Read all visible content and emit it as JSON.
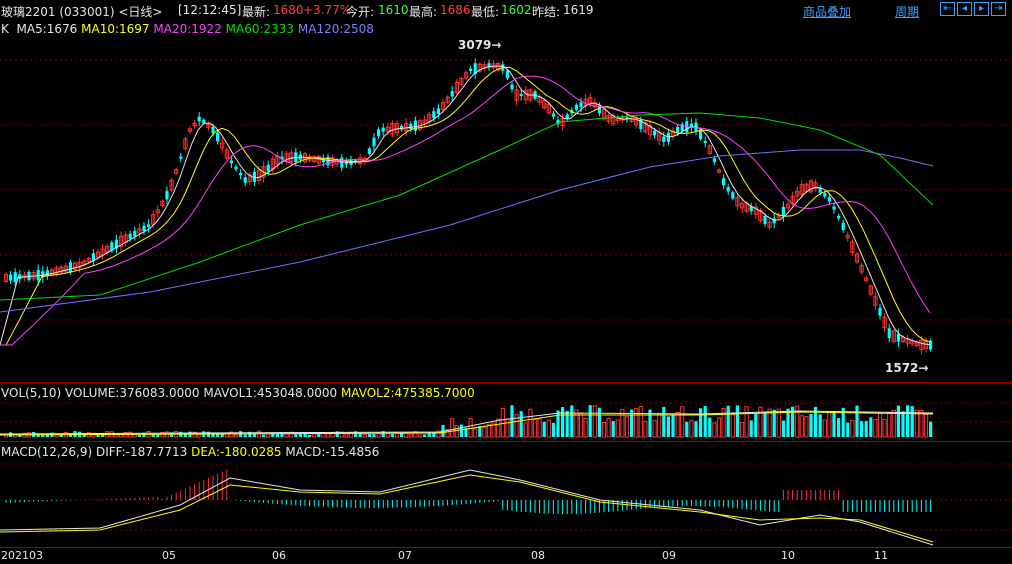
{
  "header": {
    "instrument": "玻璃2201 (033001) <日线>",
    "time": "[12:12:45]",
    "last_label": "最新:",
    "last_value": "1680",
    "change_pct": "+3.77%",
    "open_label": "今开:",
    "open_value": "1610",
    "high_label": "最高:",
    "high_value": "1686",
    "low_label": "最低:",
    "low_value": "1602",
    "prev_close_label": "昨结:",
    "prev_close_value": "1619",
    "overlay_link": "商品叠加",
    "period_link": "周期",
    "nav_icons": [
      "zoom-in-icon",
      "prev-icon",
      "next-icon",
      "zoom-out-icon"
    ]
  },
  "main_legend": {
    "k_label": "K",
    "ma5": "MA5:1676",
    "ma10": "MA10:1697",
    "ma20": "MA20:1922",
    "ma60": "MA60:2333",
    "ma120": "MA120:2508",
    "high_marker": "3079→",
    "low_marker": "1572→"
  },
  "volume_legend": {
    "title": "VOL(5,10)",
    "volume": "VOLUME:376083.0000",
    "mavol1": "MAVOL1:453048.0000",
    "mavol2": "MAVOL2:475385.7000"
  },
  "macd_legend": {
    "title": "MACD(12,26,9)",
    "diff": "DIFF:-187.7713",
    "dea": "DEA:-180.0285",
    "macd": "MACD:-15.4856"
  },
  "date_axis": {
    "start": "202103",
    "months": [
      "05",
      "06",
      "07",
      "08",
      "09",
      "10",
      "11"
    ]
  },
  "colors": {
    "up": "#ff3232",
    "down": "#00ffff",
    "ma5": "#e6e6e6",
    "ma10": "#ffff00",
    "ma20": "#ff40ff",
    "ma60": "#00e000",
    "ma120": "#7070ff"
  },
  "chart_data": {
    "type": "line",
    "title": "玻璃2201 (033001) <日线>",
    "x_range": [
      "202103",
      "11"
    ],
    "price_range": [
      1572,
      3079
    ],
    "series": [
      {
        "name": "MA5",
        "last": 1676
      },
      {
        "name": "MA10",
        "last": 1697
      },
      {
        "name": "MA20",
        "last": 1922
      },
      {
        "name": "MA60",
        "last": 2333
      },
      {
        "name": "MA120",
        "last": 2508
      }
    ],
    "volume": {
      "VOLUME": 376083,
      "MAVOL1": 453048,
      "MAVOL2": 475385.7
    },
    "macd": {
      "DIFF": -187.7713,
      "DEA": -180.0285,
      "MACD": -15.4856
    },
    "annotations": [
      "3079",
      "1572"
    ]
  }
}
